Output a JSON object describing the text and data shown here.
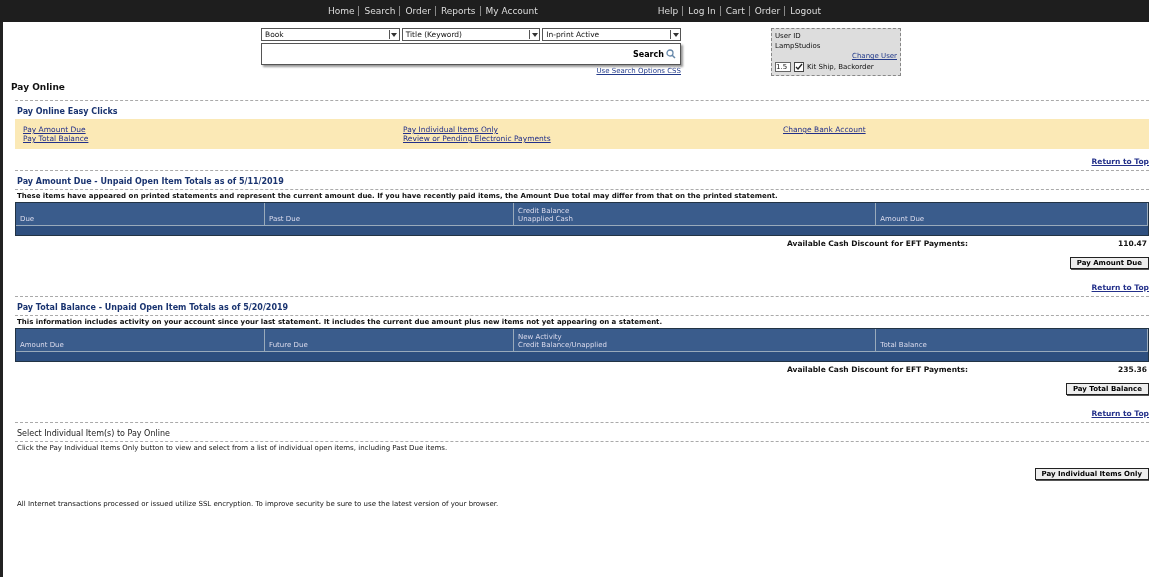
{
  "nav": {
    "left": [
      "Home",
      "Search",
      "Order",
      "Reports",
      "My Account"
    ],
    "right": [
      "Help",
      "Log In",
      "Cart",
      "Order",
      "Logout"
    ]
  },
  "search": {
    "selects": [
      {
        "value": "Book"
      },
      {
        "value": "Title (Keyword)"
      },
      {
        "value": "In-print Active"
      }
    ],
    "button": "Search",
    "link": "Use Search Options CSS"
  },
  "user_box": {
    "label": "User ID",
    "value": "LampStudios",
    "link": "Change User",
    "qty": "1.5",
    "checkbox_label": "Kit Ship, Backorder",
    "checked": true
  },
  "page_title": "Pay Online",
  "easy": {
    "title": "Pay Online Easy Clicks",
    "columns": [
      [
        "Pay Amount Due",
        "Pay Total Balance"
      ],
      [
        "Pay Individual Items Only",
        "Review or Pending Electronic Payments"
      ],
      [
        "Change Bank Account"
      ]
    ]
  },
  "sections": [
    {
      "return": "Return to Top",
      "title": "Pay Amount Due - Unpaid Open Item Totals as of 5/11/2019",
      "note": "These items have appeared on printed statements and represent the current amount due. If you have recently paid items, the Amount Due total may differ from that on the printed statement.",
      "columns": [
        {
          "label": "Due"
        },
        {
          "label": "Past Due"
        },
        {
          "label": "Credit Balance",
          "sub": "Unapplied Cash"
        },
        {
          "label": "Amount Due"
        }
      ],
      "discount_label": "Available Cash Discount for EFT Payments:",
      "discount": "110.47",
      "button": "Pay Amount Due"
    },
    {
      "return": "Return to Top",
      "title": "Pay Total Balance - Unpaid Open Item Totals as of 5/20/2019",
      "note": "This information includes activity on your account since your last statement. It includes the current due amount plus new items not yet appearing on a statement.",
      "columns": [
        {
          "label": "Amount Due"
        },
        {
          "label": "Future Due"
        },
        {
          "label": "New Activity",
          "sub": "Credit Balance/Unapplied"
        },
        {
          "label": "Total Balance"
        }
      ],
      "discount_label": "Available Cash Discount for EFT Payments:",
      "discount": "235.36",
      "button": "Pay Total Balance"
    }
  ],
  "individual": {
    "return": "Return to Top",
    "title": "Select Individual Item(s) to Pay Online",
    "note": "Click the Pay Individual Items Only button to view and select from a list of individual open items, including Past Due items.",
    "button": "Pay Individual Items Only"
  },
  "footer": "All Internet transactions processed or issued utilize SSL encryption. To improve security be sure to use the latest version of your browser."
}
